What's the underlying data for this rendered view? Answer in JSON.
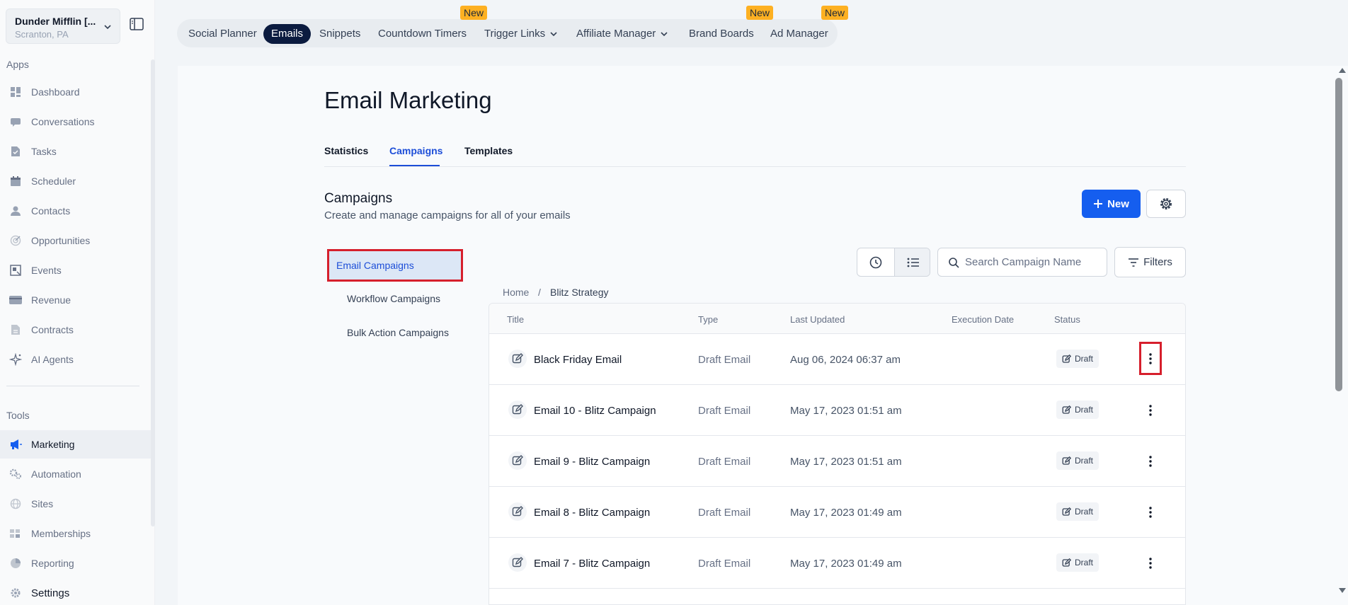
{
  "location": {
    "name": "Dunder Mifflin [...",
    "sub": "Scranton, PA"
  },
  "sidebar": {
    "apps_label": "Apps",
    "tools_label": "Tools",
    "apps": [
      {
        "label": "Dashboard",
        "icon": "dashboard-icon"
      },
      {
        "label": "Conversations",
        "icon": "chat-icon"
      },
      {
        "label": "Tasks",
        "icon": "tasks-icon"
      },
      {
        "label": "Scheduler",
        "icon": "calendar-icon"
      },
      {
        "label": "Contacts",
        "icon": "person-icon"
      },
      {
        "label": "Opportunities",
        "icon": "target-icon"
      },
      {
        "label": "Events",
        "icon": "events-icon"
      },
      {
        "label": "Revenue",
        "icon": "card-icon"
      },
      {
        "label": "Contracts",
        "icon": "document-icon"
      },
      {
        "label": "AI Agents",
        "icon": "sparkle-icon"
      }
    ],
    "tools": [
      {
        "label": "Marketing",
        "icon": "megaphone-icon",
        "active": true
      },
      {
        "label": "Automation",
        "icon": "cogs-icon"
      },
      {
        "label": "Sites",
        "icon": "globe-icon"
      },
      {
        "label": "Memberships",
        "icon": "members-icon"
      },
      {
        "label": "Reporting",
        "icon": "pie-icon"
      },
      {
        "label": "Settings",
        "icon": "gear-icon"
      }
    ]
  },
  "topnav": {
    "items": [
      {
        "label": "Social Planner"
      },
      {
        "label": "Emails",
        "active": true
      },
      {
        "label": "Snippets"
      },
      {
        "label": "Countdown Timers",
        "badge": "New"
      },
      {
        "label": "Trigger Links",
        "dropdown": true
      },
      {
        "label": "Affiliate Manager",
        "dropdown": true
      },
      {
        "label": "Brand Boards",
        "badge": "New"
      },
      {
        "label": "Ad Manager",
        "badge": "New"
      }
    ]
  },
  "page": {
    "title": "Email Marketing",
    "tabs": [
      "Statistics",
      "Campaigns",
      "Templates"
    ],
    "active_tab": "Campaigns",
    "section_title": "Campaigns",
    "section_desc": "Create and manage campaigns for all of your emails",
    "new_button": "New",
    "filters_button": "Filters",
    "search_placeholder": "Search Campaign Name",
    "subnav": [
      "Email Campaigns",
      "Workflow Campaigns",
      "Bulk Action Campaigns"
    ],
    "breadcrumb": {
      "home": "Home",
      "sep": "/",
      "current": "Blitz Strategy"
    }
  },
  "table": {
    "headers": [
      "Title",
      "Type",
      "Last Updated",
      "Execution Date",
      "Status"
    ],
    "rows": [
      {
        "title": "Black Friday Email",
        "type": "Draft Email",
        "updated": "Aug 06, 2024 06:37 am",
        "status": "Draft"
      },
      {
        "title": "Email 10 - Blitz Campaign",
        "type": "Draft Email",
        "updated": "May 17, 2023 01:51 am",
        "status": "Draft"
      },
      {
        "title": "Email 9 - Blitz Campaign",
        "type": "Draft Email",
        "updated": "May 17, 2023 01:51 am",
        "status": "Draft"
      },
      {
        "title": "Email 8 - Blitz Campaign",
        "type": "Draft Email",
        "updated": "May 17, 2023 01:49 am",
        "status": "Draft"
      },
      {
        "title": "Email 7 - Blitz Campaign",
        "type": "Draft Email",
        "updated": "May 17, 2023 01:49 am",
        "status": "Draft"
      }
    ]
  },
  "colors": {
    "primary": "#155eef",
    "nav_active": "#0b1b3f",
    "badge": "#fdb022",
    "highlight": "#d61f2c"
  }
}
